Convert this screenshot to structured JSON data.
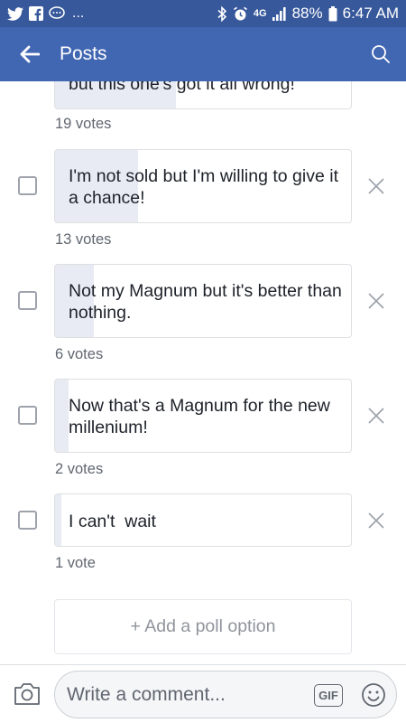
{
  "status_bar": {
    "left_icons": [
      "twitter-icon",
      "facebook-icon",
      "chat-icon"
    ],
    "ellipsis": "...",
    "right_icons": [
      "bluetooth-icon",
      "alarm-icon",
      "lte-icon",
      "signal-icon",
      "battery-icon"
    ],
    "lte_label": "4G",
    "battery": "88%",
    "time": "6:47 AM"
  },
  "header": {
    "title": "Posts",
    "back_icon": "back-arrow-icon",
    "search_icon": "search-icon"
  },
  "poll": {
    "options": [
      {
        "text": "but this one's got it all wrong!",
        "votes_label": "19 votes",
        "fill": 0.41,
        "removable": false
      },
      {
        "text": "I'm not sold but I'm willing to give it a chance!",
        "votes_label": "13 votes",
        "fill": 0.28,
        "removable": true
      },
      {
        "text": "Not my Magnum but it's better than nothing.",
        "votes_label": "6 votes",
        "fill": 0.13,
        "removable": true
      },
      {
        "text": "Now that's a Magnum for the new millenium!",
        "votes_label": "2 votes",
        "fill": 0.045,
        "removable": true
      },
      {
        "text": "I can't  wait",
        "votes_label": "1 vote",
        "fill": 0.02,
        "removable": true
      }
    ],
    "add_option_label": "+ Add a poll option"
  },
  "composer": {
    "placeholder": "Write a comment...",
    "gif_label": "GIF",
    "camera_icon": "camera-icon",
    "emoji_icon": "emoji-icon"
  },
  "colors": {
    "header_bg": "#4267b2",
    "status_bg": "#37589b",
    "vote_fill": "#e9ebf4",
    "text": "#1d2129",
    "muted": "#606770"
  }
}
